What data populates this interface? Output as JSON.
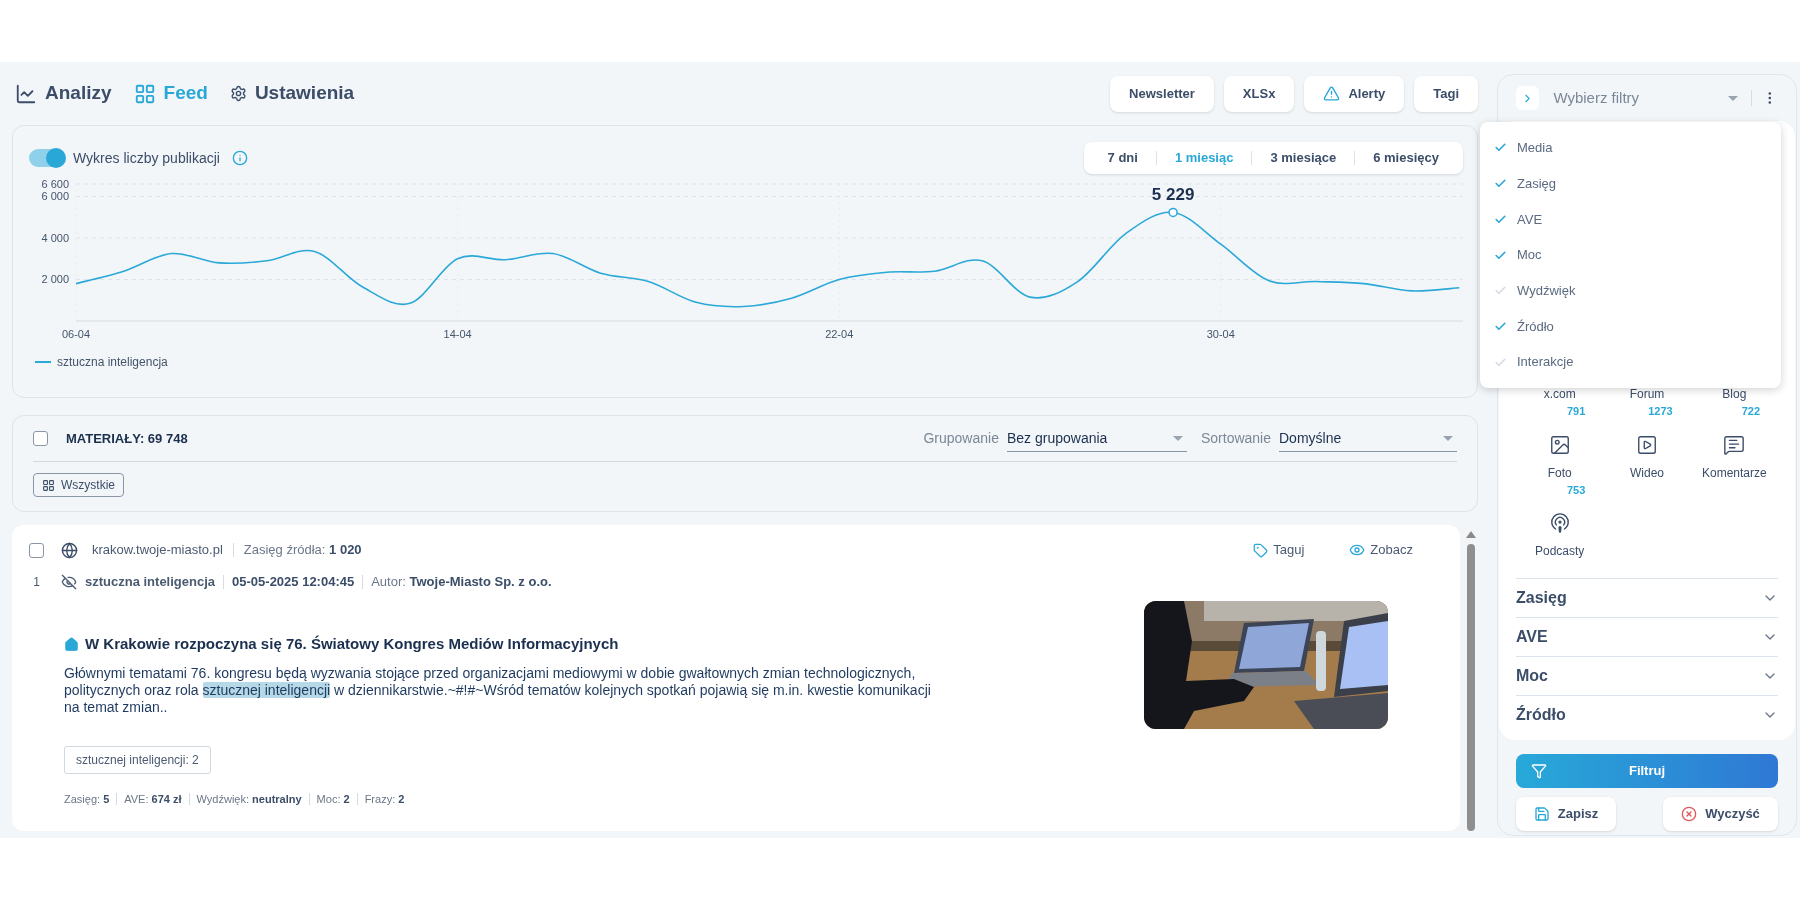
{
  "nav": [
    {
      "label": "Analizy",
      "selected": false
    },
    {
      "label": "Feed",
      "selected": true
    },
    {
      "label": "Ustawienia",
      "selected": false
    }
  ],
  "actions": [
    {
      "label": "Newsletter",
      "kind": "plain"
    },
    {
      "label": "XLSx",
      "kind": "plain"
    },
    {
      "label": "Alerty",
      "kind": "warning"
    },
    {
      "label": "Tagi",
      "kind": "plain"
    }
  ],
  "chart_panel": {
    "toggle": {
      "label": "Wykres liczby publikacji",
      "on": true
    },
    "periods": [
      {
        "label": "7 dni",
        "selected": false
      },
      {
        "label": "1 miesiąc",
        "selected": true
      },
      {
        "label": "3 miesiące",
        "selected": false
      },
      {
        "label": "6 miesięcy",
        "selected": false
      }
    ],
    "chart_data": {
      "type": "line",
      "categories": [
        "06-04",
        null,
        null,
        null,
        null,
        null,
        null,
        null,
        "14-04",
        null,
        null,
        null,
        null,
        null,
        null,
        null,
        "22-04",
        null,
        null,
        null,
        null,
        null,
        null,
        null,
        "30-04",
        null,
        null,
        null,
        null,
        null
      ],
      "ylim": [
        0,
        6600
      ],
      "yticks": [
        {
          "value": 2000,
          "label": "2 000"
        },
        {
          "value": 4000,
          "label": "4 000"
        },
        {
          "value": 6000,
          "label": "6 000"
        },
        {
          "value": 6600,
          "label": "6 600"
        }
      ],
      "series": [
        {
          "name": "sztuczna inteligencja",
          "color": "#2aa8d8",
          "values": [
            1800,
            2400,
            3250,
            2800,
            2900,
            3350,
            1650,
            850,
            3000,
            2950,
            3250,
            2300,
            1900,
            900,
            700,
            1100,
            2000,
            2350,
            2400,
            2900,
            1150,
            1900,
            4200,
            5229,
            3700,
            1950,
            1900,
            1800,
            1450,
            1600
          ]
        }
      ],
      "grid": true,
      "annotations": [
        {
          "y": 5229,
          "text": "5 229"
        }
      ]
    }
  },
  "materials": {
    "checked": false,
    "label": "MATERIAŁY:",
    "count": "69 748",
    "grouping": {
      "label": "Grupowanie",
      "value": "Bez grupowania"
    },
    "sorting": {
      "label": "Sortowanie",
      "value": "Domyślne"
    },
    "filter_chip": "Wszystkie"
  },
  "articles": [
    {
      "checked": false,
      "number": "1",
      "source": "krakow.twoje-miasto.pl",
      "reach_label": "Zasięg źródła:",
      "reach": "1 020",
      "actions": [
        "Taguj",
        "Zobacz"
      ],
      "phrase": "sztuczna inteligencja",
      "date": "05-05-2025 12:04:45",
      "author_label": "Autor:",
      "author": "Twoje-Miasto Sp. z o.o.",
      "title": "W Krakowie rozpoczyna się 76. Światowy Kongres Mediów Informacyjnych",
      "body": [
        {
          "text": "Głównymi tematami 76. kongresu będą wyzwania stojące przed organizacjami mediowymi w dobie gwałtownych zmian technologicznych, politycznych oraz rola ",
          "highlighted": false
        },
        {
          "text": "sztucznej inteligencji",
          "highlighted": true
        },
        {
          "text": " w dziennikarstwie.~#!#~Wśród tematów kolejnych spotkań pojawią się m.in. kwestie komunikacji na temat zmian..",
          "highlighted": false
        }
      ],
      "phrase_chip": "sztucznej inteligencji: 2",
      "metrics": [
        {
          "label": "Zasięg:",
          "value": "5"
        },
        {
          "label": "AVE:",
          "value": "674 zł"
        },
        {
          "label": "Wydźwięk:",
          "value": "neutralny"
        },
        {
          "label": "Moc:",
          "value": "2"
        },
        {
          "label": "Frazy:",
          "value": "2"
        }
      ]
    }
  ],
  "filters": {
    "placeholder": "Wybierz filtry",
    "menu": [
      {
        "label": "Media",
        "checked": true
      },
      {
        "label": "Zasięg",
        "checked": true
      },
      {
        "label": "AVE",
        "checked": true
      },
      {
        "label": "Moc",
        "checked": true
      },
      {
        "label": "Wydźwięk",
        "checked": false
      },
      {
        "label": "Źródło",
        "checked": true
      },
      {
        "label": "Interakcje",
        "checked": false
      }
    ],
    "media_types": [
      {
        "label": "x.com",
        "count": "791"
      },
      {
        "label": "Forum",
        "count": "1273"
      },
      {
        "label": "Blog",
        "count": "722"
      },
      {
        "label": "Foto",
        "count": "753"
      },
      {
        "label": "Wideo"
      },
      {
        "label": "Komentarze"
      },
      {
        "label": "Podcasty"
      }
    ],
    "sections": [
      {
        "label": "Zasięg",
        "expanded": false
      },
      {
        "label": "AVE",
        "expanded": false
      },
      {
        "label": "Moc",
        "expanded": false
      },
      {
        "label": "Źródło",
        "expanded": false
      }
    ],
    "filter_button": "Filtruj",
    "save_button": "Zapisz",
    "clear_button": "Wyczyść"
  }
}
